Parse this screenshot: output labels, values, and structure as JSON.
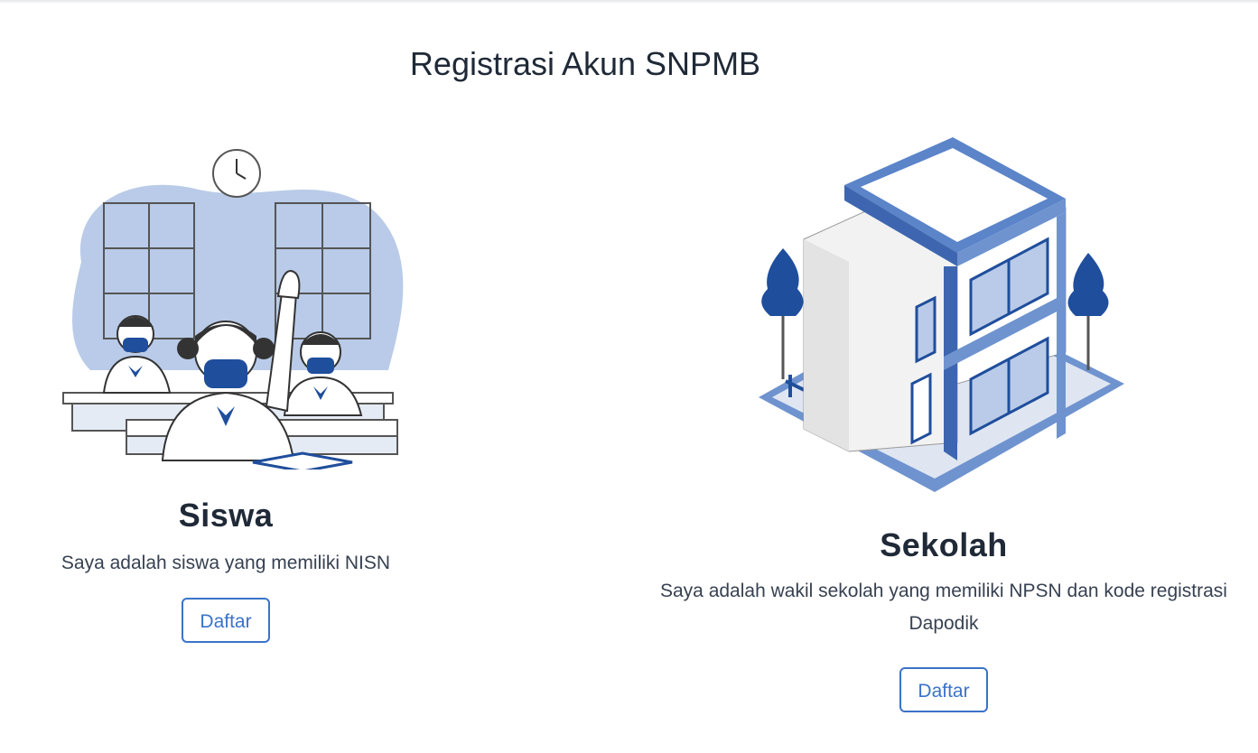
{
  "page": {
    "title": "Registrasi Akun SNPMB"
  },
  "cards": [
    {
      "title": "Siswa",
      "description": "Saya adalah siswa yang memiliki NISN",
      "button_label": "Daftar",
      "illustration": "students-classroom-illustration"
    },
    {
      "title": "Sekolah",
      "description": "Saya adalah wakil sekolah yang memiliki NPSN dan kode registrasi Dapodik",
      "button_label": "Daftar",
      "illustration": "school-building-illustration"
    }
  ],
  "colors": {
    "accent": "#3b73c8",
    "illustration_blue": "#1f4e9c",
    "illustration_light": "#b9cbe8",
    "text": "#1f2937"
  }
}
